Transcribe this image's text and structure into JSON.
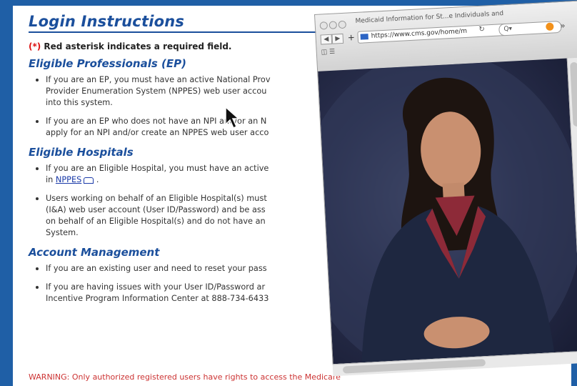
{
  "page": {
    "title": "Login Instructions",
    "required_note_star": "(*)",
    "required_note_text": " Red asterisk indicates a required field."
  },
  "sections": [
    {
      "heading": "Eligible Professionals (EP)",
      "items": [
        [
          "If you are an EP, you must have an active National Prov",
          "Provider Enumeration System (NPPES) web user accou",
          "into this system."
        ],
        [
          "If you are an EP who does not have an NPI and/or an N",
          "apply for an NPI and/or create an NPPES web user acco"
        ]
      ]
    },
    {
      "heading": "Eligible Hospitals",
      "items": [
        [
          "If you are an Eligible Hospital, you must have an active",
          "in "
        ],
        [
          "Users working on behalf of an Eligible Hospital(s) must",
          "(I&A) web user account (User ID/Password) and be ass",
          "on behalf of an Eligible Hospital(s) and do not have an",
          "System."
        ]
      ],
      "link_text": "NPPES"
    },
    {
      "heading": "Account Management",
      "items": [
        [
          "If you are an existing user and need to reset your pass"
        ],
        [
          "If you are having issues with your User ID/Password ar",
          "Incentive Program Information Center at 888-734-6433"
        ]
      ]
    }
  ],
  "warning": "WARNING:  Only authorized registered users have rights to access the Medicare",
  "popup": {
    "window_title": "Medicaid Information for St...e Individuals and",
    "url": "https://www.cms.gov/home/m",
    "search_placeholder": "Q▾",
    "back_icon": "back-arrow-icon",
    "forward_icon": "forward-arrow-icon",
    "reload_icon": "reload-icon",
    "rss_icon": "rss-icon",
    "bookmarks_icon": "bookmarks-icon",
    "colors": {
      "video_bg": "#2b3150",
      "suit": "#1e2740",
      "shirt": "#8d2a38"
    }
  }
}
